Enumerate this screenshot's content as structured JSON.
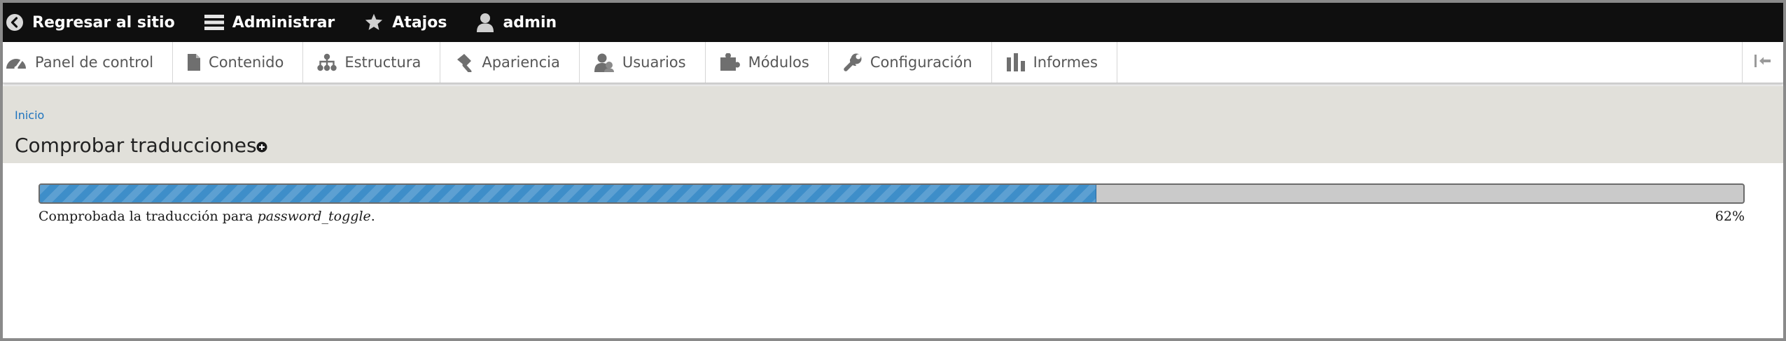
{
  "toolbar": {
    "back_label": "Regresar al sitio",
    "manage_label": "Administrar",
    "shortcuts_label": "Atajos",
    "user_label": "admin"
  },
  "tray": {
    "items": [
      {
        "label": "Panel de control",
        "icon": "dashboard-icon"
      },
      {
        "label": "Contenido",
        "icon": "document-icon"
      },
      {
        "label": "Estructura",
        "icon": "sitemap-icon"
      },
      {
        "label": "Apariencia",
        "icon": "paint-brush-icon"
      },
      {
        "label": "Usuarios",
        "icon": "users-icon"
      },
      {
        "label": "Módulos",
        "icon": "puzzle-icon"
      },
      {
        "label": "Configuración",
        "icon": "wrench-icon"
      },
      {
        "label": "Informes",
        "icon": "bar-chart-icon"
      }
    ],
    "collapse_icon": "collapse-sidebar-icon"
  },
  "header": {
    "breadcrumb": "Inicio",
    "title": "Comprobar traducciones",
    "shortcut_icon": "add-shortcut-icon"
  },
  "progress": {
    "message_prefix": "Comprobada la traducción para ",
    "message_item": "password_toggle",
    "message_suffix": ".",
    "percent_label": "62%",
    "fraction": 0.62,
    "fill_color": "#3e8ec9"
  }
}
